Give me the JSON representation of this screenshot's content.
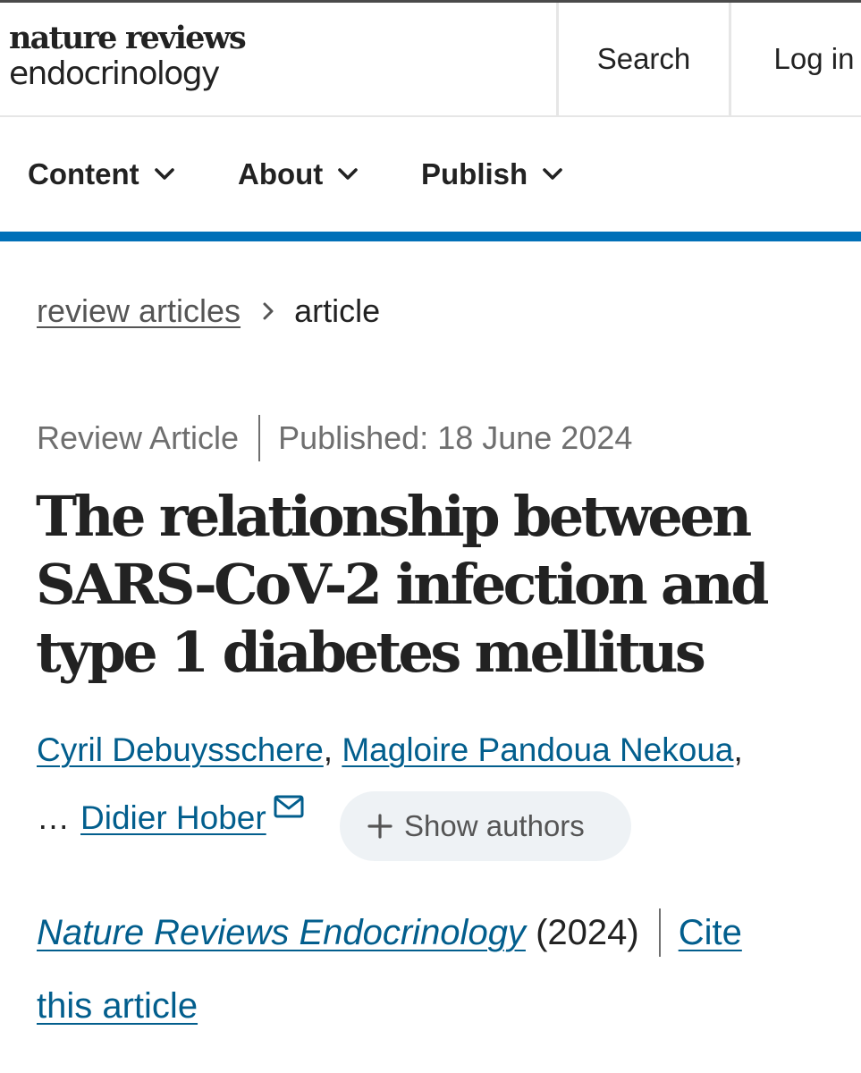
{
  "header": {
    "logo_line1": "nature reviews",
    "logo_line2": "endocrinology",
    "search_label": "Search",
    "login_label": "Log in"
  },
  "nav": {
    "items": [
      {
        "label": "Content",
        "icon": "chevron-down-icon"
      },
      {
        "label": "About",
        "icon": "chevron-down-icon"
      },
      {
        "label": "Publish",
        "icon": "chevron-down-icon"
      }
    ]
  },
  "colors": {
    "accent_bar": "#0070b8",
    "link": "#025e8d",
    "muted_text": "#6f6f6f",
    "pill_background": "#eef2f5"
  },
  "breadcrumb": {
    "parent": "review articles",
    "separator_icon": "chevron-right-icon",
    "current": "article"
  },
  "article": {
    "type": "Review Article",
    "published": "Published: 18 June 2024",
    "title": "The relationship between SARS-CoV-2 infection and type 1 diabetes mellitus",
    "authors": {
      "author1": "Cyril Debuysschere",
      "separator1": ",",
      "author2": "Magloire Pandoua Nekoua",
      "separator2": ",",
      "ellipsis": "…",
      "author_last": "Didier Hober",
      "corresponding_icon": "mail-icon",
      "show_authors_label": "Show authors"
    },
    "citation": {
      "journal": "Nature Reviews Endocrinology",
      "year": "(2024)",
      "cite_line1": "Cite",
      "cite_line2": "this article"
    }
  }
}
